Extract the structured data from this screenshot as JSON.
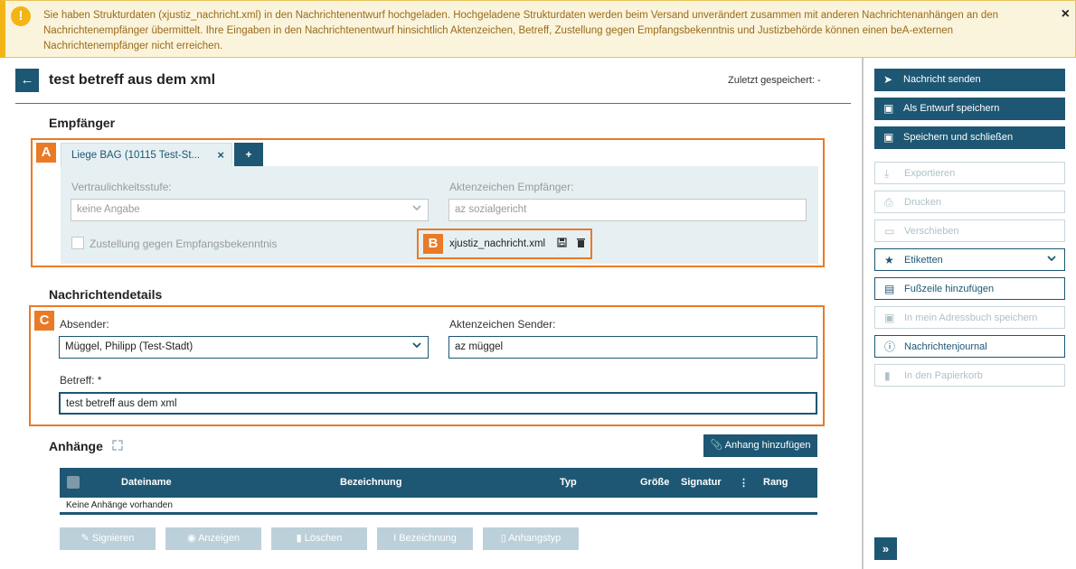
{
  "banner": {
    "icon": "exclamation-icon",
    "text": "Sie haben Strukturdaten (xjustiz_nachricht.xml) in den Nachrichtenentwurf hochgeladen. Hochgeladene Strukturdaten werden beim Versand unverändert zusammen mit anderen Nachrichtenanhängen an den Nachrichtenempfänger übermittelt. Ihre Eingaben in den Nachrichtenentwurf hinsichtlich Aktenzeichen, Betreff, Zustellung gegen Empfangsbekenntnis und Justizbehörde können einen beA-externen Nachrichtenempfänger nicht erreichen.",
    "close": "×"
  },
  "header": {
    "back": "←",
    "title": "test betreff aus dem xml",
    "last_saved": "Zuletzt gespeichert: -"
  },
  "callouts": {
    "a": "A",
    "b": "B",
    "c": "C"
  },
  "recipients": {
    "heading": "Empfänger",
    "tab_label": "Liege BAG (10115 Test-St...",
    "tab_close": "×",
    "add_tab": "+",
    "confidentiality_label": "Vertraulichkeitsstufe:",
    "confidentiality_value": "keine Angabe",
    "recipient_ref_label": "Aktenzeichen Empfänger:",
    "recipient_ref_placeholder": "az sozialgericht",
    "receipt_checkbox_label": "Zustellung gegen Empfangsbekenntnis",
    "xml_file_name": "xjustiz_nachricht.xml"
  },
  "details": {
    "heading": "Nachrichtendetails",
    "sender_label": "Absender:",
    "sender_value": "Müggel, Philipp (Test-Stadt)",
    "sender_ref_label": "Aktenzeichen Sender:",
    "sender_ref_value": "az müggel",
    "subject_label": "Betreff: *",
    "subject_value": "test betreff aus dem xml"
  },
  "attachments": {
    "heading": "Anhänge",
    "add_button": "Anhang hinzufügen",
    "columns": [
      "Dateiname",
      "Bezeichnung",
      "Typ",
      "Größe",
      "Signatur",
      "⋮",
      "Rang"
    ],
    "empty_text": "Keine Anhänge vorhanden",
    "actions": [
      "Signieren",
      "Anzeigen",
      "Löschen",
      "Bezeichnung",
      "Anhangstyp"
    ]
  },
  "sidebar": {
    "send": "Nachricht senden",
    "save_draft": "Als Entwurf speichern",
    "save_close": "Speichern und schließen",
    "export": "Exportieren",
    "print": "Drucken",
    "move": "Verschieben",
    "labels": "Etiketten",
    "add_footer": "Fußzeile hinzufügen",
    "address_book": "In mein Adressbuch speichern",
    "journal": "Nachrichtenjournal",
    "trash": "In den Papierkorb",
    "expand": "»"
  },
  "colors": {
    "primary": "#1d5773",
    "accent_orange": "#ea7a25",
    "warning": "#f3b515"
  }
}
